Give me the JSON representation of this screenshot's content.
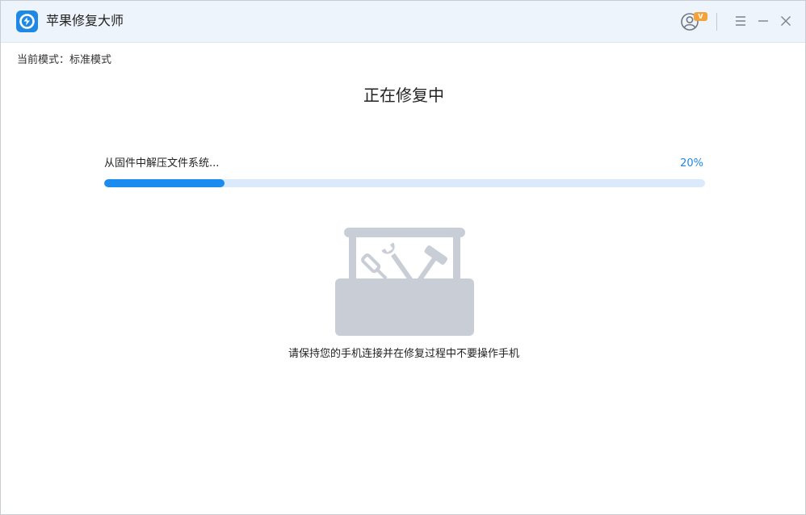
{
  "app": {
    "title": "苹果修复大师"
  },
  "header": {
    "vip_badge": "V"
  },
  "mode": {
    "label": "当前模式：标准模式"
  },
  "main": {
    "heading": "正在修复中",
    "progress": {
      "status_text": "从固件中解压文件系统...",
      "percent_label": "20%",
      "fraction": 0.2
    },
    "hint": "请保持您的手机连接并在修复过程中不要操作手机"
  },
  "colors": {
    "accent": "#1a8cf0",
    "track": "#dbeafb",
    "titlebar": "#eef4fb",
    "illustration": "#c9ced6",
    "badge": "#f5a13a"
  },
  "icons": [
    "app-logo-icon",
    "user-account-icon",
    "menu-icon",
    "minimize-icon",
    "close-icon",
    "toolbox-icon"
  ]
}
